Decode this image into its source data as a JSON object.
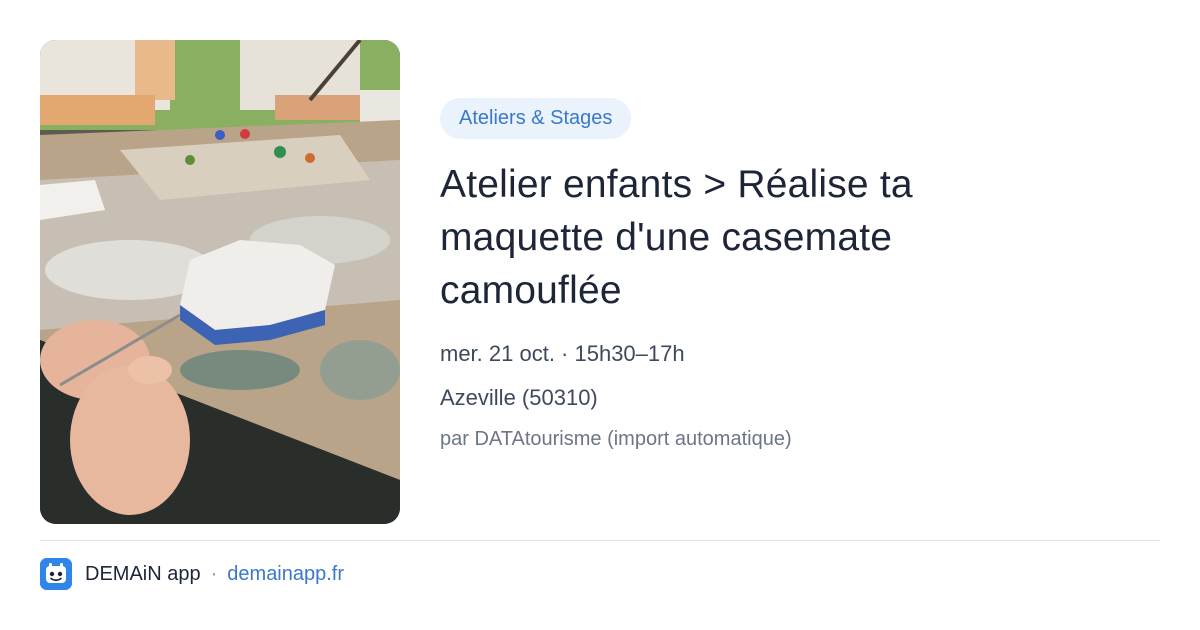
{
  "event": {
    "category": "Ateliers & Stages",
    "title": "Atelier enfants > Réalise ta maquette d'une casemate camouflée",
    "date_time": "mer. 21 oct. · 15h30–17h",
    "location": "Azeville (50310)",
    "source": "par DATAtourisme (import automatique)"
  },
  "footer": {
    "app_name": "DEMAiN app",
    "separator": "·",
    "link": "demainapp.fr",
    "icon": "app-logo-icon"
  },
  "colors": {
    "accent": "#3a78c9",
    "pill_bg": "#eaf2fc",
    "title": "#1d2637",
    "text": "#3e4a5c",
    "muted": "#6b7686",
    "divider": "#dbe2e8"
  }
}
